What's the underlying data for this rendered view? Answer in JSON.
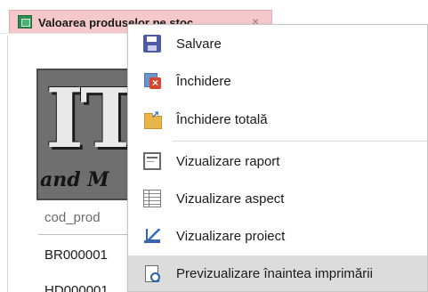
{
  "tab": {
    "title": "Valoarea produselor pe stoc",
    "close_glyph": "×",
    "icon": "report-icon"
  },
  "report": {
    "logo": {
      "main": "IT",
      "sub": "and M"
    },
    "column_header": "cod_prod",
    "rows": [
      "BR000001",
      "HD000001"
    ]
  },
  "context_menu": {
    "items": [
      {
        "label": "Salvare",
        "icon": "save-icon"
      },
      {
        "label": "Închidere",
        "icon": "close-doc-icon"
      },
      {
        "label": "Închidere totală",
        "icon": "close-all-icon"
      },
      {
        "label": "Vizualizare raport",
        "icon": "report-view-icon"
      },
      {
        "label": "Vizualizare aspect",
        "icon": "layout-view-icon"
      },
      {
        "label": "Vizualizare proiect",
        "icon": "design-view-icon"
      },
      {
        "label": "Previzualizare înaintea imprimării",
        "icon": "print-preview-icon",
        "highlighted": true
      }
    ]
  },
  "colors": {
    "tab_background": "#f5c9cc",
    "highlight": "#dcdcdc",
    "accent_blue": "#4d5aa8"
  }
}
